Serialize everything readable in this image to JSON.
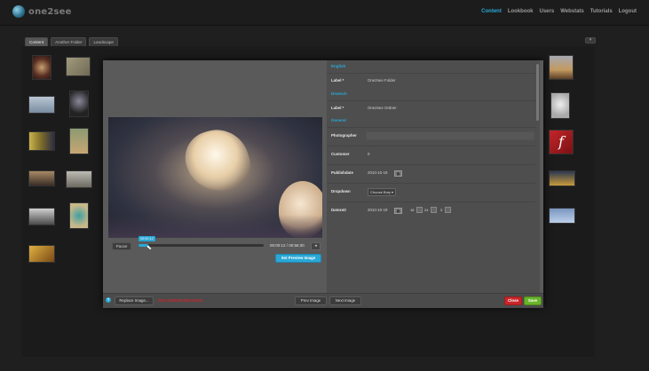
{
  "app": {
    "logo_text": "one2see",
    "nav": [
      "Content",
      "Lookbook",
      "Users",
      "Webstats",
      "Tutorials",
      "Logout"
    ],
    "active_nav": "Content"
  },
  "tabs": [
    "Content",
    "Another Folder",
    "Landscape"
  ],
  "player": {
    "pause_label": "Pause",
    "current_time_tip": "00:00:12",
    "time_display": "00:00:12 / 00:56:30",
    "progress_fraction": 0.0035,
    "set_preview_label": "Set Preview Image"
  },
  "form": {
    "section_english": "English",
    "english_label_field": "Label *",
    "english_label_value": "One2see Folder",
    "section_deutsch": "Deutsch",
    "deutsch_label_field": "Label *",
    "deutsch_label_value": "One2see Ordner",
    "section_general": "General",
    "photographer_label": "Photographer",
    "photographer_value": "",
    "customer_label": "Customer",
    "customer_value": "0",
    "publishdate_label": "Publishdate",
    "publishdate_value": "2010-10-19",
    "dropdown_label": "Dropdown",
    "dropdown_value": "Choose Bmy",
    "datezeit_label": "Datezeit",
    "datezeit_date": "2010-10-19",
    "datezeit_hour": "16",
    "datezeit_minute": "24",
    "datezeit_second": "3"
  },
  "footer": {
    "help_symbol": "?",
    "replace_label": "Replace Image...",
    "warning_text": "WAS ERROR MESSAGE",
    "prev_label": "Prev Image",
    "next_label": "Next Image",
    "close_label": "Close",
    "save_label": "Save"
  },
  "colors": {
    "accent": "#29a8d6",
    "close": "#c8262a",
    "save": "#6ab42a"
  }
}
